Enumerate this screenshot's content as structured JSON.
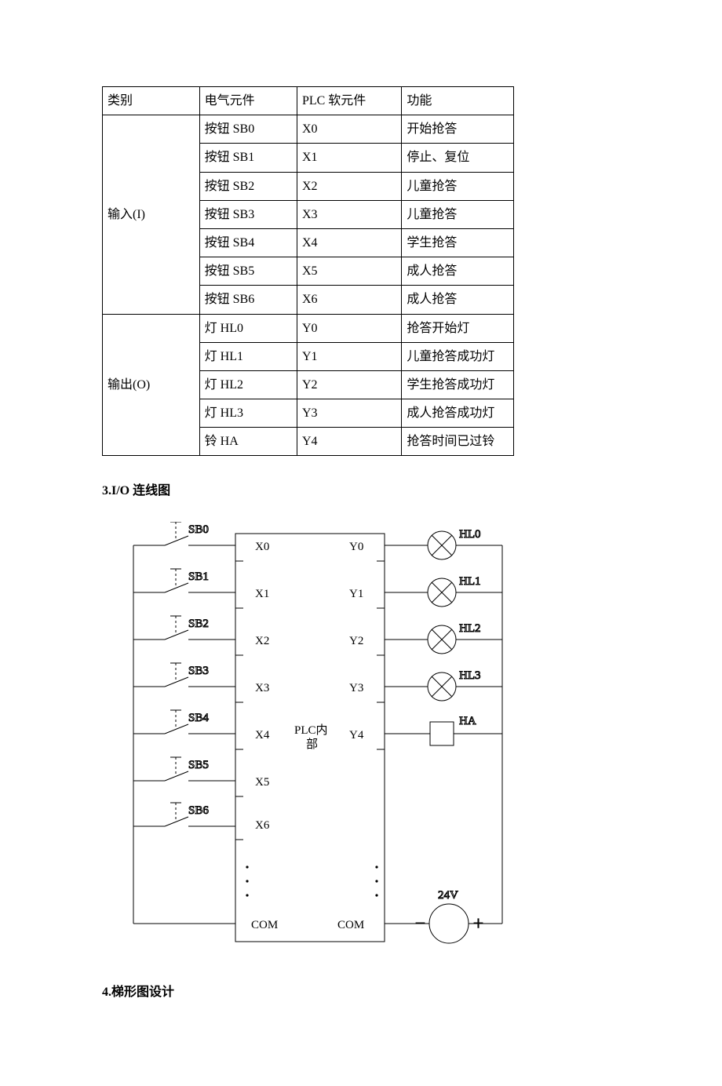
{
  "table": {
    "header": {
      "c1": "类别",
      "c2": "电气元件",
      "c3": "PLC 软元件",
      "c4": "功能"
    },
    "input_label": "输入(I)",
    "output_label": "输出(O)",
    "inputs": [
      {
        "elem": "按钮 SB0",
        "plc": "X0",
        "func": "开始抢答"
      },
      {
        "elem": "按钮 SB1",
        "plc": "X1",
        "func": "停止、复位"
      },
      {
        "elem": "按钮 SB2",
        "plc": "X2",
        "func": "儿童抢答"
      },
      {
        "elem": "按钮 SB3",
        "plc": "X3",
        "func": "儿童抢答"
      },
      {
        "elem": "按钮 SB4",
        "plc": "X4",
        "func": "学生抢答"
      },
      {
        "elem": "按钮 SB5",
        "plc": "X5",
        "func": "成人抢答"
      },
      {
        "elem": "按钮 SB6",
        "plc": "X6",
        "func": "成人抢答"
      }
    ],
    "outputs": [
      {
        "elem": "灯 HL0",
        "plc": "Y0",
        "func": "抢答开始灯"
      },
      {
        "elem": "灯 HL1",
        "plc": "Y1",
        "func": "儿童抢答成功灯"
      },
      {
        "elem": "灯 HL2",
        "plc": "Y2",
        "func": "学生抢答成功灯"
      },
      {
        "elem": "灯 HL3",
        "plc": "Y3",
        "func": "成人抢答成功灯"
      },
      {
        "elem": "铃 HA",
        "plc": "Y4",
        "func": "抢答时间已过铃"
      }
    ]
  },
  "section3": "3.I/O 连线图",
  "section4": "4.梯形图设计",
  "diagram": {
    "sb": [
      "SB0",
      "SB1",
      "SB2",
      "SB3",
      "SB4",
      "SB5",
      "SB6"
    ],
    "x": [
      "X0",
      "X1",
      "X2",
      "X3",
      "X4",
      "X5",
      "X6"
    ],
    "y": [
      "Y0",
      "Y1",
      "Y2",
      "Y3",
      "Y4"
    ],
    "hl": [
      "HL0",
      "HL1",
      "HL2",
      "HL3",
      "HA"
    ],
    "plc_label_1": "PLC内",
    "plc_label_2": "部",
    "com": "COM",
    "v24": "24V",
    "minus": "－",
    "plus": "＋"
  }
}
